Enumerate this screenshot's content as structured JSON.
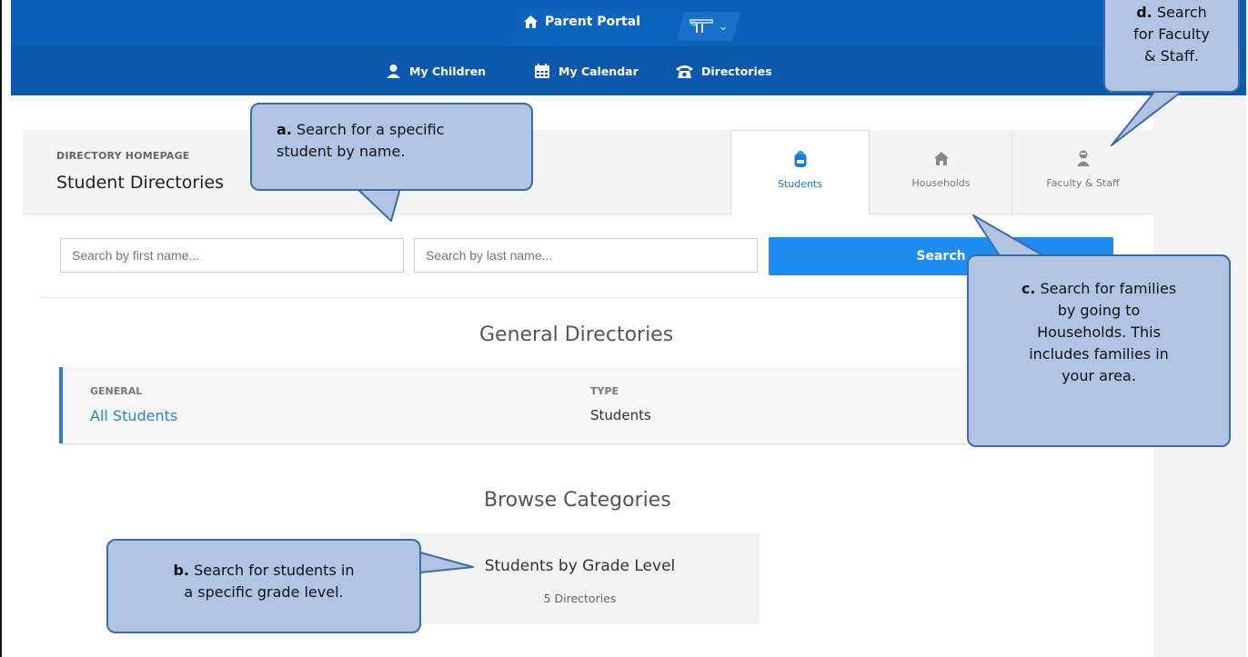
{
  "topbar": {
    "portal_label": "Parent Portal",
    "switch_label": "⌄"
  },
  "subnav": {
    "items": [
      {
        "label": "My Children",
        "icon": "person-icon"
      },
      {
        "label": "My Calendar",
        "icon": "calendar-icon"
      },
      {
        "label": "Directories",
        "icon": "phone-icon"
      }
    ]
  },
  "directory": {
    "kicker": "DIRECTORY HOMEPAGE",
    "title": "Student Directories",
    "tabs": [
      {
        "label": "Students",
        "icon": "backpack-icon"
      },
      {
        "label": "Households",
        "icon": "house-icon"
      },
      {
        "label": "Faculty & Staff",
        "icon": "staff-icon"
      }
    ]
  },
  "search": {
    "first_placeholder": "Search by first name...",
    "last_placeholder": "Search by last name...",
    "button_label": "Search"
  },
  "general": {
    "section_title": "General Directories",
    "col1_header": "GENERAL",
    "col1_value": "All Students",
    "col2_header": "TYPE",
    "col2_value": "Students"
  },
  "browse": {
    "section_title": "Browse Categories",
    "category_title": "Students by Grade Level",
    "category_count": "5 Directories"
  },
  "callouts": {
    "a_letter": "a.",
    "a_text_1": " Search for a specific",
    "a_text_2": "student by name.",
    "b_letter": "b.",
    "b_text_1": " Search for students in",
    "b_text_2": "a specific grade level.",
    "c_letter": "c.",
    "c_text_1": " Search for families",
    "c_text_2": "by going to",
    "c_text_3": "Households. This",
    "c_text_4": "includes families in",
    "c_text_5": "your area.",
    "d_letter": "d.",
    "d_text_1": " Search",
    "d_text_2": "for Faculty",
    "d_text_3": "& Staff."
  },
  "colors": {
    "topbar": "#0b5fb5",
    "accent": "#1e8cf0",
    "callout_fill": "#b0c4e4",
    "callout_border": "#3f6ca5"
  }
}
